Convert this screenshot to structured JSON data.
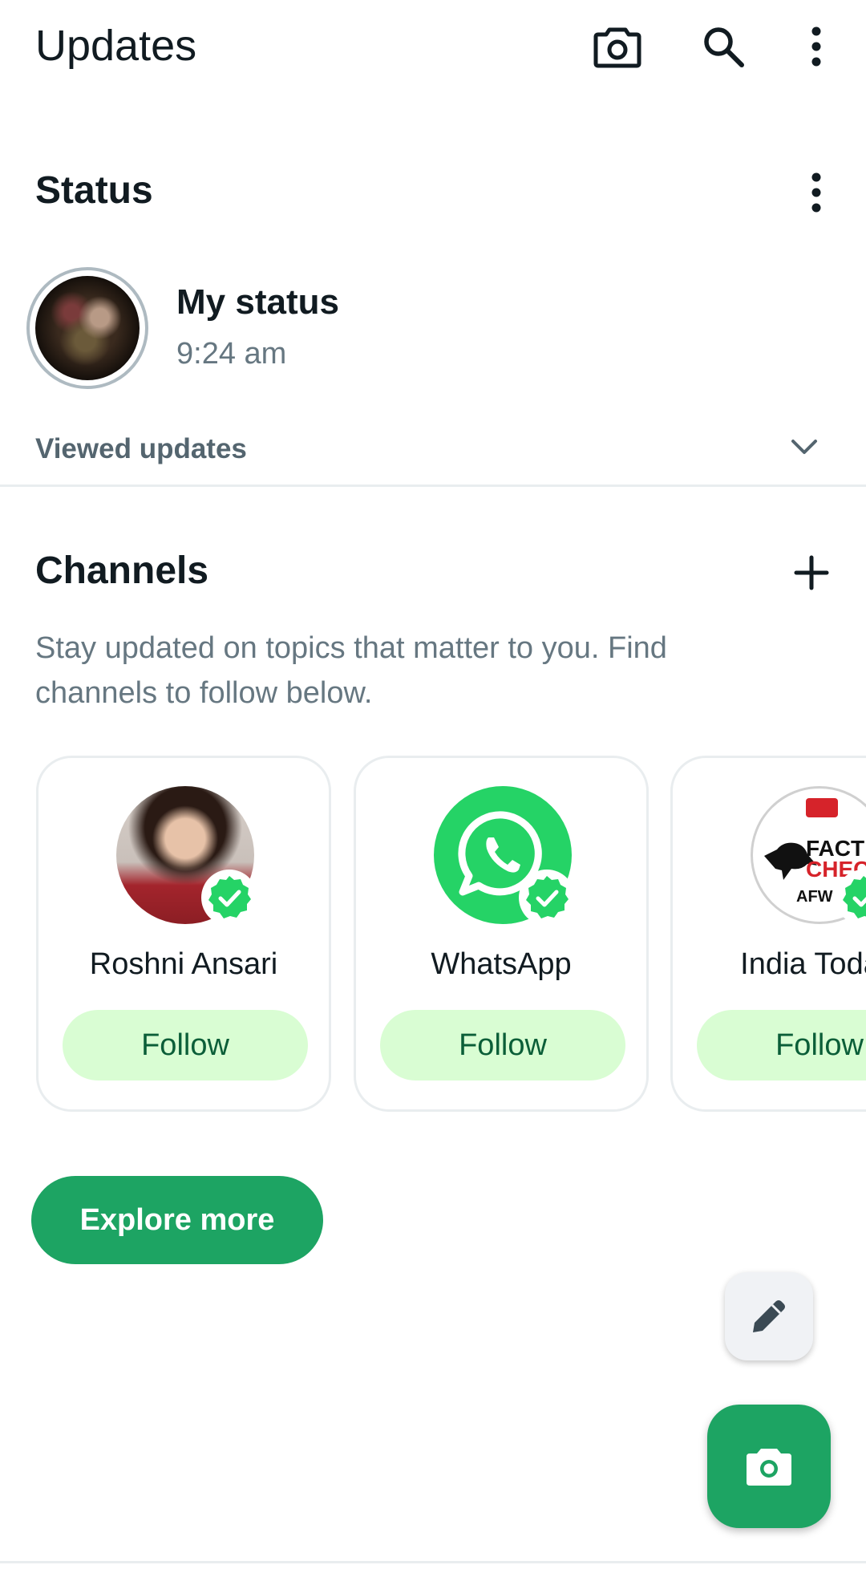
{
  "app_bar": {
    "title": "Updates",
    "icons": [
      "camera-icon",
      "search-icon",
      "more-vert-icon"
    ]
  },
  "status": {
    "title": "Status",
    "menu_icon": "more-vert-icon",
    "my_status": {
      "name": "My status",
      "time": "9:24 am"
    },
    "viewed_updates": {
      "label": "Viewed updates",
      "icon": "chevron-down-icon"
    }
  },
  "channels": {
    "title": "Channels",
    "add_icon": "plus-icon",
    "description": "Stay updated on topics that matter to you. Find channels to follow below.",
    "cards": [
      {
        "name": "Roshni Ansari",
        "follow_label": "Follow",
        "verified": true
      },
      {
        "name": "WhatsApp",
        "follow_label": "Follow",
        "verified": true
      },
      {
        "name": "India Today",
        "follow_label": "Follow",
        "verified": true,
        "logo_text": [
          "FACT",
          "CHECK",
          "AFW"
        ]
      }
    ],
    "explore_label": "Explore more"
  },
  "fabs": {
    "secondary_icon": "pencil-icon",
    "primary_icon": "camera-icon"
  },
  "colors": {
    "accent": "#1da463",
    "follow_bg": "#d9fdd3",
    "follow_text": "#0b5e38",
    "verified": "#25d366",
    "muted_text": "#667781"
  }
}
